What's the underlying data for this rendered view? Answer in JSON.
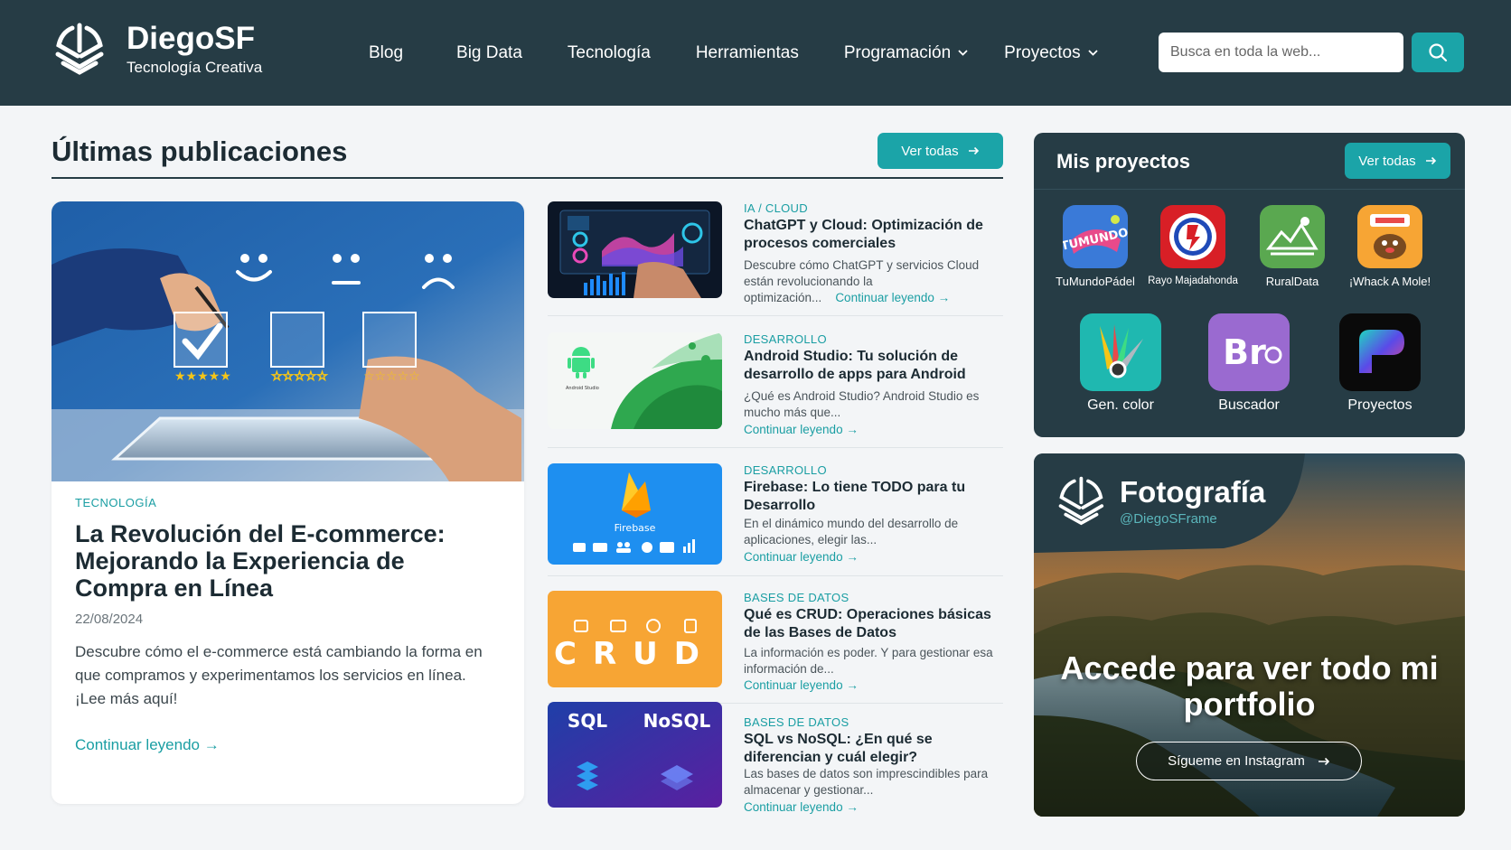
{
  "header": {
    "brand": "DiegoSF",
    "tagline": "Tecnología Creativa",
    "nav": [
      {
        "label": "Blog",
        "dropdown": false
      },
      {
        "label": "Big Data",
        "dropdown": false
      },
      {
        "label": "Tecnología",
        "dropdown": false
      },
      {
        "label": "Herramientas",
        "dropdown": false
      },
      {
        "label": "Programación",
        "dropdown": true
      },
      {
        "label": "Proyectos",
        "dropdown": true
      }
    ],
    "search_placeholder": "Busca en toda la web...",
    "search_icon": "search-icon"
  },
  "latest": {
    "title": "Últimas publicaciones",
    "see_all": "Ver todas"
  },
  "featured": {
    "category": "TECNOLOGÍA",
    "title": "La Revolución del E-commerce: Mejorando la Experiencia de Compra en Línea",
    "date": "22/08/2024",
    "description": "Descubre cómo el e-commerce está cambiando la forma en que compramos y experimentamos los servicios en línea. ¡Lee más aquí!",
    "read_more": "Continuar leyendo"
  },
  "articles": [
    {
      "category": "IA / CLOUD",
      "title": "ChatGPT y Cloud: Optimización de procesos comerciales",
      "description": "Descubre cómo ChatGPT y servicios Cloud están revolucionando la optimización...",
      "read_more": "Continuar leyendo"
    },
    {
      "category": "DESARROLLO",
      "title": "Android Studio: Tu solución de desarrollo de apps para Android",
      "description": "¿Qué es Android Studio? Android Studio es mucho más que...",
      "read_more": "Continuar leyendo",
      "thumb_text": "Android Studio"
    },
    {
      "category": "DESARROLLO",
      "title": "Firebase: Lo tiene TODO para tu Desarrollo",
      "description": "En el dinámico mundo del desarrollo de aplicaciones, elegir las...",
      "read_more": "Continuar leyendo",
      "thumb_text": "Firebase"
    },
    {
      "category": "BASES DE DATOS",
      "title": "Qué es CRUD: Operaciones básicas de las Bases de Datos",
      "description": "La información es poder. Y para gestionar esa información de...",
      "read_more": "Continuar leyendo",
      "thumb_text": "CRUD"
    },
    {
      "category": "BASES DE DATOS",
      "title": "SQL vs NoSQL: ¿En qué se diferencian y cuál elegir?",
      "description": "Las bases de datos son imprescindibles para almacenar y gestionar...",
      "read_more": "Continuar leyendo",
      "thumb_left": "SQL",
      "thumb_right": "NoSQL"
    }
  ],
  "projects": {
    "title": "Mis proyectos",
    "see_all": "Ver todas",
    "apps_row1": [
      {
        "label": "TuMundoPádel",
        "icon": "tumundopadel-icon"
      },
      {
        "label": "Rayo Majadahonda",
        "icon": "rayo-majadahonda-icon"
      },
      {
        "label": "RuralData",
        "icon": "ruraldata-icon"
      },
      {
        "label": "¡Whack A Mole!",
        "icon": "whack-a-mole-icon"
      }
    ],
    "apps_row2": [
      {
        "label": "Gen. color",
        "icon": "color-generator-icon"
      },
      {
        "label": "Buscador",
        "icon": "buscador-icon",
        "icon_text": "Br"
      },
      {
        "label": "Proyectos",
        "icon": "proyectos-icon"
      }
    ]
  },
  "photography": {
    "title": "Fotografía",
    "handle": "@DiegoSFrame",
    "cta": "Accede para ver todo mi portfolio",
    "button": "Sígueme en Instagram"
  },
  "colors": {
    "header_bg": "#263c45",
    "accent": "#1ba4a8",
    "page_bg": "#f3f5f7"
  }
}
